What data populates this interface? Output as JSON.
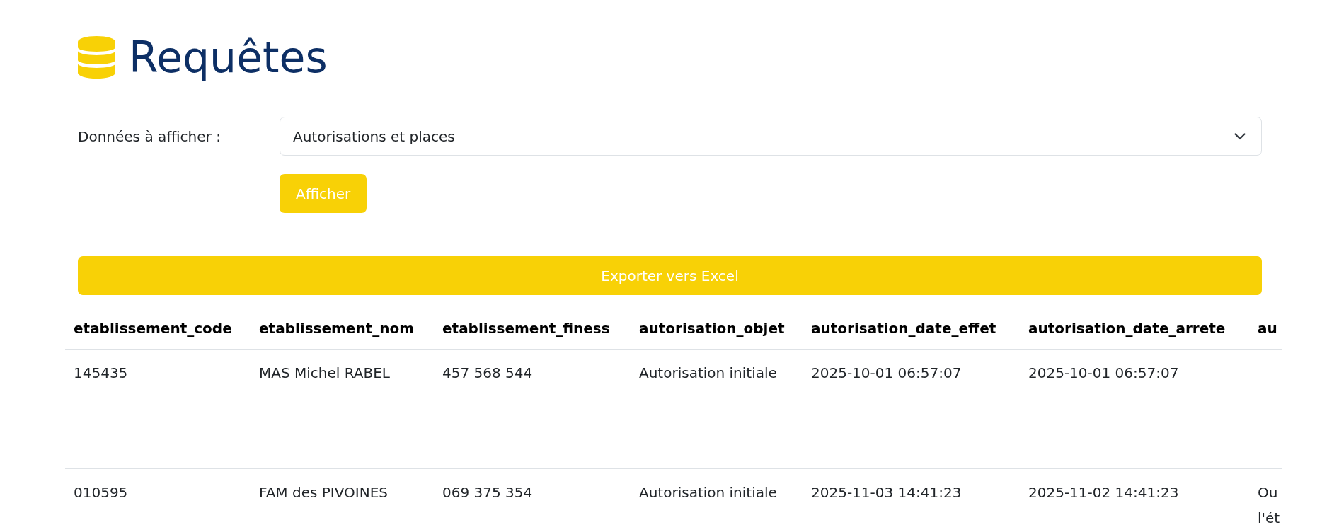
{
  "page": {
    "title": "Requêtes"
  },
  "filter": {
    "label": "Données à afficher :",
    "select": {
      "value": "Autorisations et places"
    },
    "submit_button": "Afficher"
  },
  "export_button": "Exporter vers Excel",
  "table": {
    "columns": [
      "etablissement_code",
      "etablissement_nom",
      "etablissement_finess",
      "autorisation_objet",
      "autorisation_date_effet",
      "autorisation_date_arrete",
      "au"
    ],
    "rows": [
      {
        "cells": [
          "145435",
          "MAS Michel RABEL",
          "457 568 544",
          "Autorisation initiale",
          "2025-10-01 06:57:07",
          "2025-10-01 06:57:07"
        ]
      },
      {
        "cells": [
          "010595",
          "FAM des PIVOINES",
          "069 375 354",
          "Autorisation initiale",
          "2025-11-03 14:41:23",
          "2025-11-02 14:41:23",
          "Ou l'ét"
        ]
      }
    ]
  }
}
